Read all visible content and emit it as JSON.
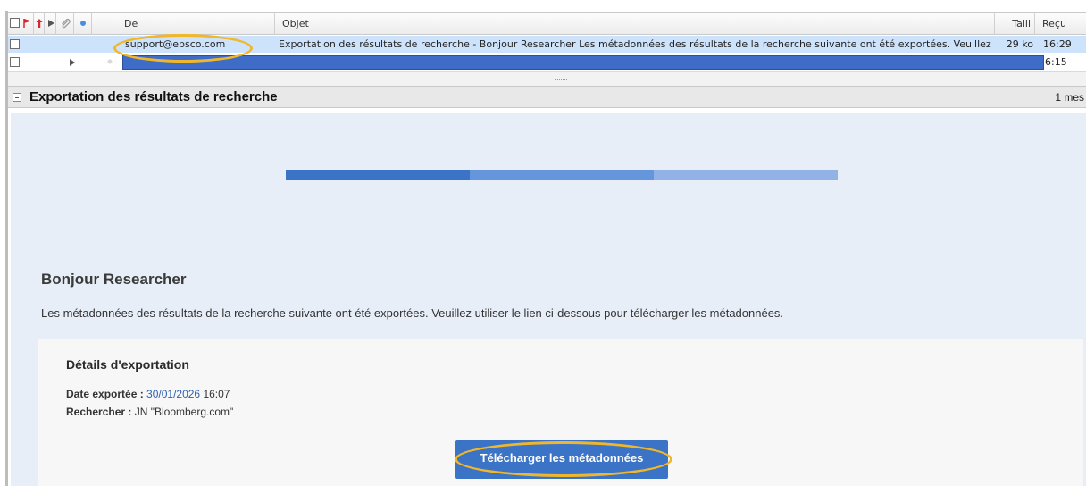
{
  "list": {
    "columns": {
      "from": "De",
      "subject": "Objet",
      "size": "Taill",
      "received": "Reçu"
    },
    "rows": [
      {
        "from": "support@ebsco.com",
        "subject": "Exportation des résultats de recherche - Bonjour Researcher Les métadonnées des résultats de la recherche suivante ont été exportées. Veuillez utilis",
        "size": "29 ko",
        "received": "16:29",
        "selected": true
      },
      {
        "from": "",
        "subject": "",
        "size": "",
        "received": "6:15",
        "selected": false,
        "redacted": true
      }
    ]
  },
  "pane": {
    "title": "Exportation des résultats de recherche",
    "count": "1 mes"
  },
  "email": {
    "banner_colors": [
      "#3b73c6",
      "#6595da",
      "#92b1e4"
    ],
    "greeting": "Bonjour Researcher",
    "intro": "Les métadonnées des résultats de la recherche suivante ont été exportées. Veuillez utiliser le lien ci-dessous pour télécharger les métadonnées.",
    "card": {
      "title": "Détails d'exportation",
      "date_label": "Date exportée :",
      "date_value": "30/01/2026",
      "time_value": "16:07",
      "search_label": "Rechercher :",
      "search_value": "JN \"Bloomberg.com\""
    },
    "download_label": "Télécharger les métadonnées"
  },
  "colors": {
    "selection": "#cde3fb",
    "accent": "#3b73c6",
    "highlight_annotation": "#f0b72a",
    "flag": "#d9262b"
  }
}
